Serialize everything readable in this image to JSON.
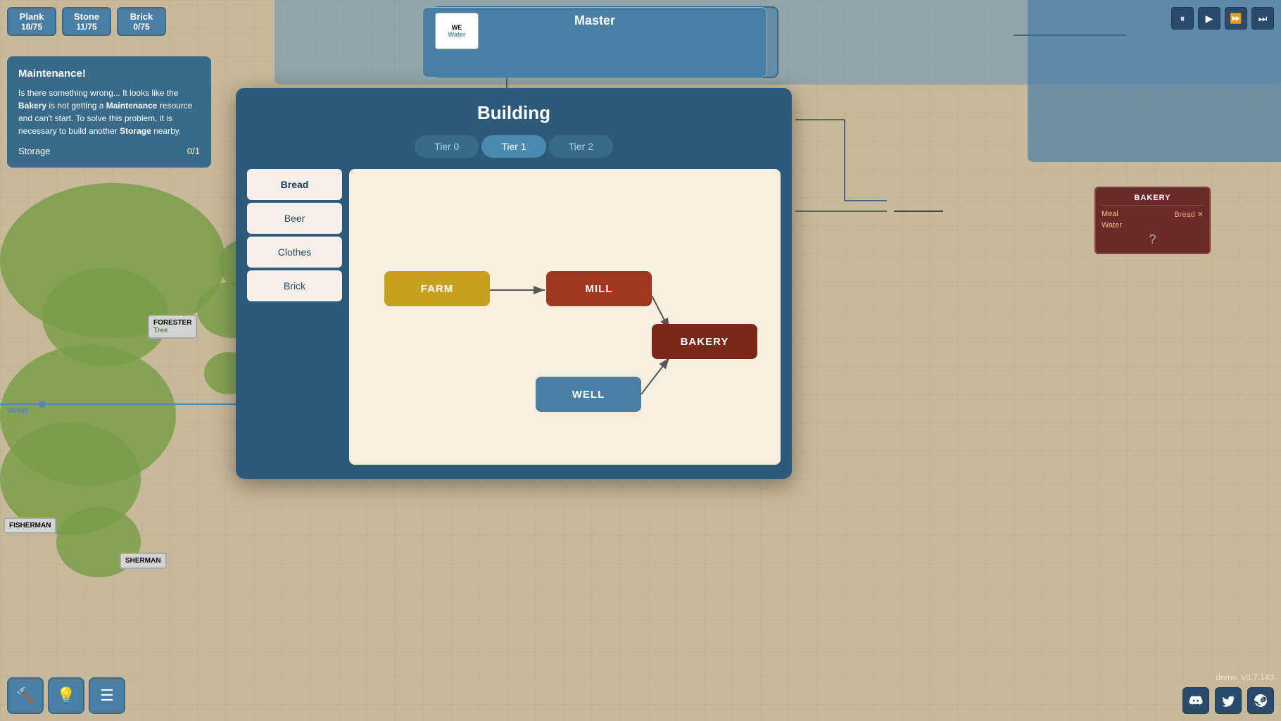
{
  "resources": [
    {
      "name": "Plank",
      "value": "18/75"
    },
    {
      "name": "Stone",
      "value": "11/75"
    },
    {
      "name": "Brick",
      "value": "0/75"
    }
  ],
  "playback": {
    "buttons": [
      "⏸",
      "▶",
      "⏩",
      "⏭"
    ]
  },
  "maintenance": {
    "title": "Maintenance!",
    "body1": "Is there something wrong... It looks like the ",
    "bold1": "Bakery",
    "body2": " is not getting a ",
    "bold2": "Maintenance",
    "body3": " resource and can't start. To solve this problem, it is necessary to build another ",
    "bold3": "Storage",
    "body4": " nearby.",
    "storage_label": "Storage",
    "storage_value": "0/1"
  },
  "dialog": {
    "title": "Building",
    "tabs": [
      "Tier 0",
      "Tier 1",
      "Tier 2"
    ],
    "active_tab": 1,
    "items": [
      "Bread",
      "Beer",
      "Clothes",
      "Brick"
    ],
    "active_item": 0,
    "flow_nodes": [
      {
        "id": "farm",
        "label": "FARM"
      },
      {
        "id": "mill",
        "label": "MILL"
      },
      {
        "id": "bakery",
        "label": "BAKERY"
      },
      {
        "id": "well",
        "label": "WELL"
      }
    ]
  },
  "bakery_card": {
    "title": "BAKERY",
    "inputs": [
      {
        "label": "Meal",
        "arrow": "→",
        "output": "Bread ✕"
      }
    ],
    "water": "Water",
    "question": "?"
  },
  "map": {
    "master_label": "Master",
    "well_label": "WE",
    "water_label": "Water",
    "forester_label": "FORESTER",
    "forester_sub": "Tree",
    "fisherman_label": "FISHERMAN",
    "sherman_label": "SHERMAN"
  },
  "toolbar": {
    "hammer": "🔨",
    "bulb": "💡",
    "menu": "☰"
  },
  "version": "demo_v0.7.143",
  "social": [
    "discord",
    "twitter",
    "steam"
  ]
}
